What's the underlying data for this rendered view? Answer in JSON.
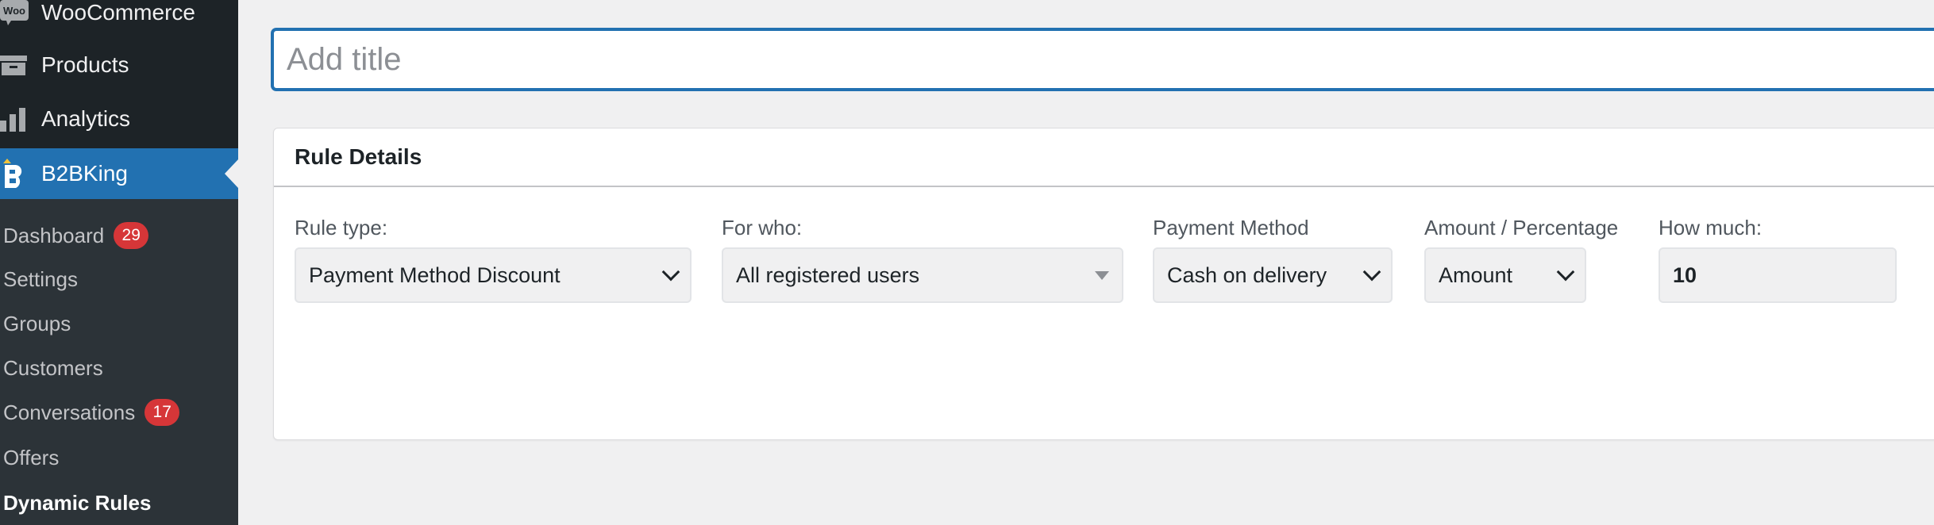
{
  "sidebar": {
    "menu": [
      {
        "label": "WooCommerce",
        "icon": "woo-icon"
      },
      {
        "label": "Products",
        "icon": "archive-icon"
      },
      {
        "label": "Analytics",
        "icon": "chart-bar-icon"
      },
      {
        "label": "B2BKing",
        "icon": "b2bking-logo-icon"
      }
    ],
    "woo_icon_text": "Woo",
    "submenu": [
      {
        "label": "Dashboard",
        "badge": "29"
      },
      {
        "label": "Settings"
      },
      {
        "label": "Groups"
      },
      {
        "label": "Customers"
      },
      {
        "label": "Conversations",
        "badge": "17"
      },
      {
        "label": "Offers"
      },
      {
        "label": "Dynamic Rules"
      }
    ]
  },
  "main": {
    "title_placeholder": "Add title",
    "panel": {
      "title": "Rule Details",
      "fields": [
        {
          "label": "Rule type:",
          "value": "Payment Method Discount"
        },
        {
          "label": "For who:",
          "value": "All registered users"
        },
        {
          "label": "Payment Method",
          "value": "Cash on delivery"
        },
        {
          "label": "Amount / Percentage",
          "value": "Amount"
        },
        {
          "label": "How much:",
          "value": "10"
        }
      ]
    }
  },
  "colors": {
    "sidebar_bg": "#1d2327",
    "submenu_bg": "#2c3338",
    "accent": "#2271b1",
    "badge": "#d63638"
  }
}
